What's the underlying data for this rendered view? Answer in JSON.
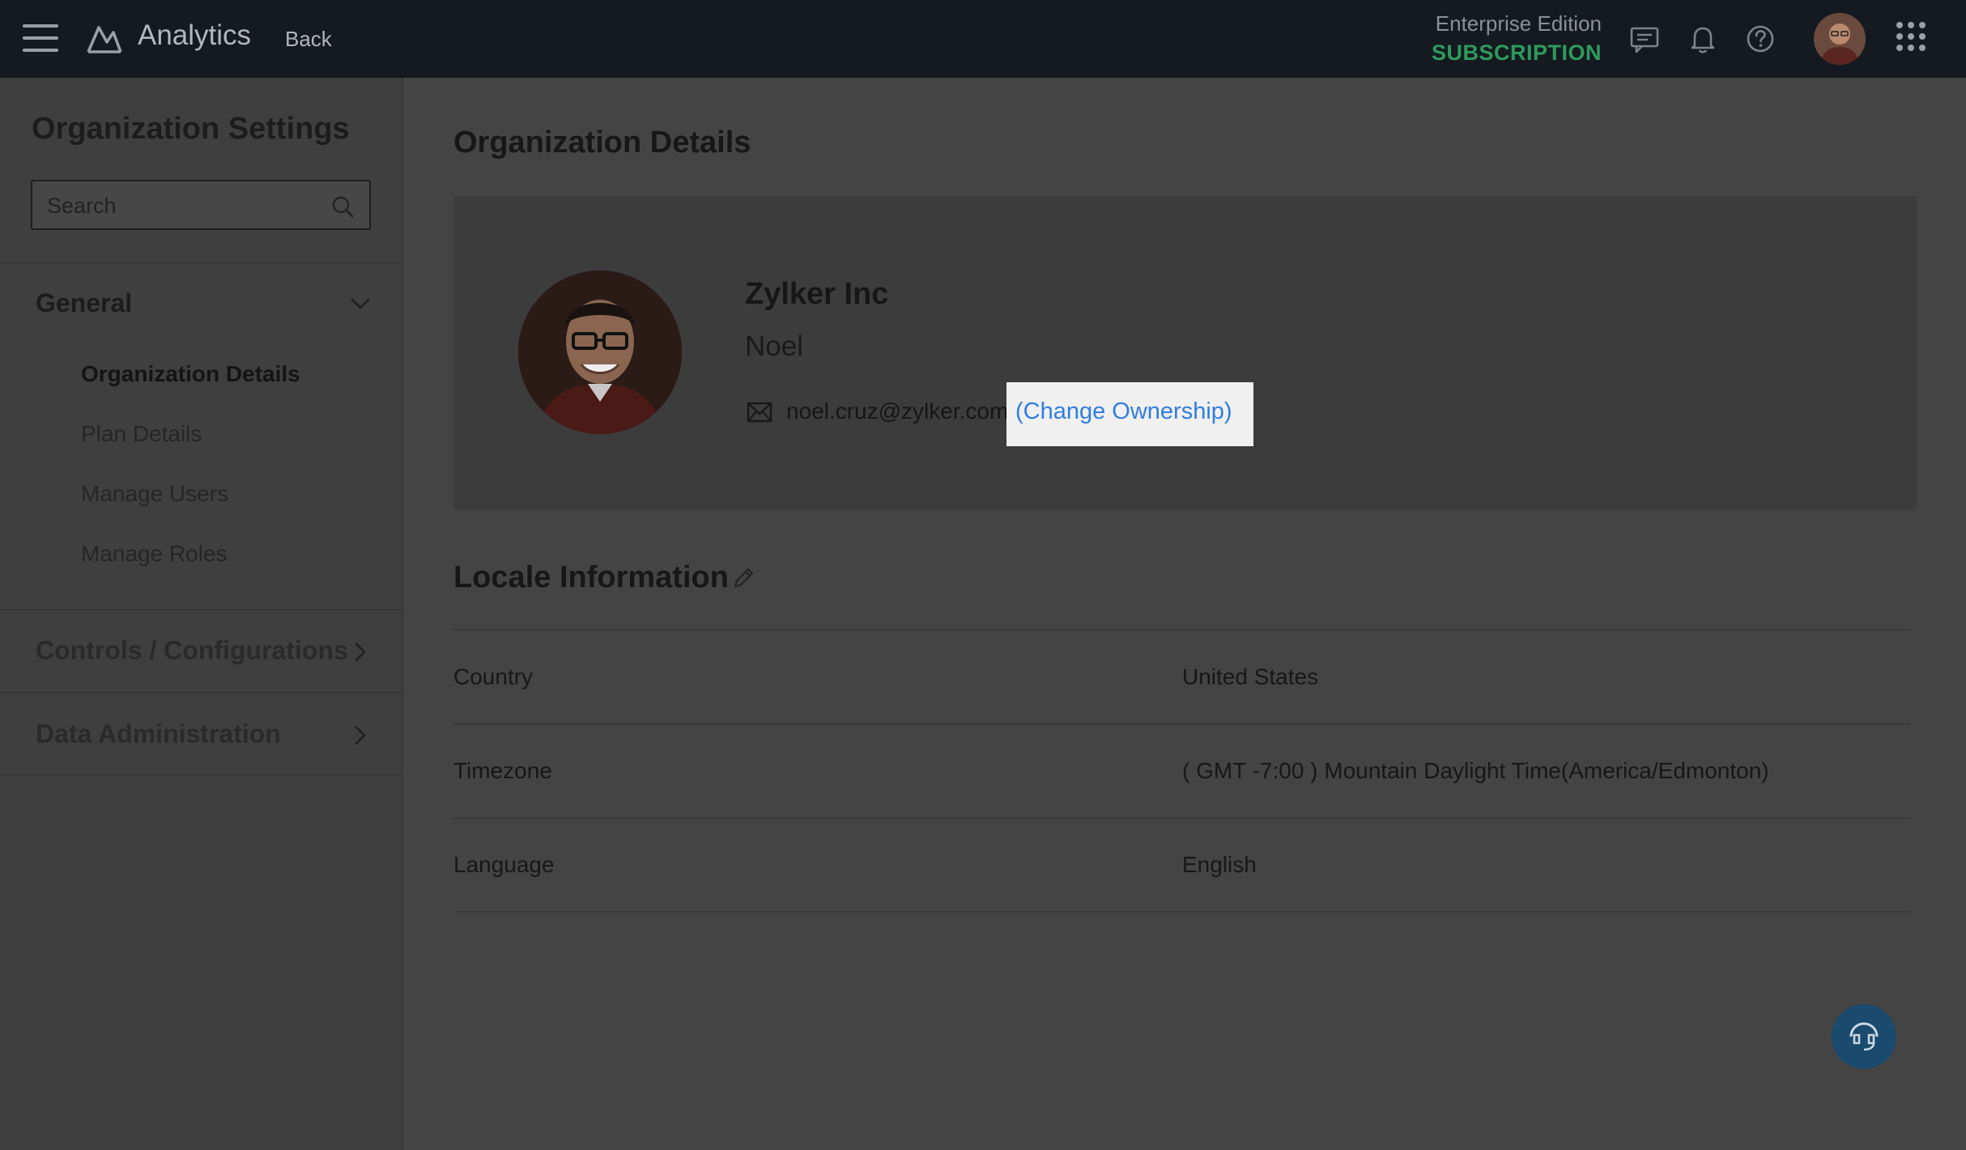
{
  "header": {
    "app_title": "Analytics",
    "back_label": "Back",
    "edition": "Enterprise Edition",
    "subscription": "SUBSCRIPTION",
    "icons": [
      "menu-icon",
      "analytics-logo-icon",
      "chat-icon",
      "bell-icon",
      "help-icon",
      "apps-grid-icon"
    ]
  },
  "sidebar": {
    "title": "Organization Settings",
    "search_placeholder": "Search",
    "sections": [
      {
        "label": "General",
        "expanded": true,
        "items": [
          {
            "label": "Organization Details",
            "active": true
          },
          {
            "label": "Plan Details",
            "active": false
          },
          {
            "label": "Manage Users",
            "active": false
          },
          {
            "label": "Manage Roles",
            "active": false
          }
        ]
      },
      {
        "label": "Controls / Configurations",
        "expanded": false
      },
      {
        "label": "Data Administration",
        "expanded": false
      }
    ]
  },
  "main": {
    "title": "Organization Details",
    "org": {
      "name": "Zylker Inc",
      "owner": "Noel",
      "email": "noel.cruz@zylker.com",
      "change_ownership": "(Change Ownership)"
    },
    "locale": {
      "title": "Locale Information",
      "rows": [
        {
          "label": "Country",
          "value": "United States"
        },
        {
          "label": "Timezone",
          "value": "( GMT -7:00 ) Mountain Daylight Time(America/Edmonton)"
        },
        {
          "label": "Language",
          "value": "English"
        }
      ]
    }
  },
  "colors": {
    "topbar": "#141a20",
    "overlay": "#444444",
    "subscription": "#2e9a5c",
    "link": "#2f7ee0",
    "highlight": "#f0f0f0",
    "fab": "#1a4a6e"
  }
}
